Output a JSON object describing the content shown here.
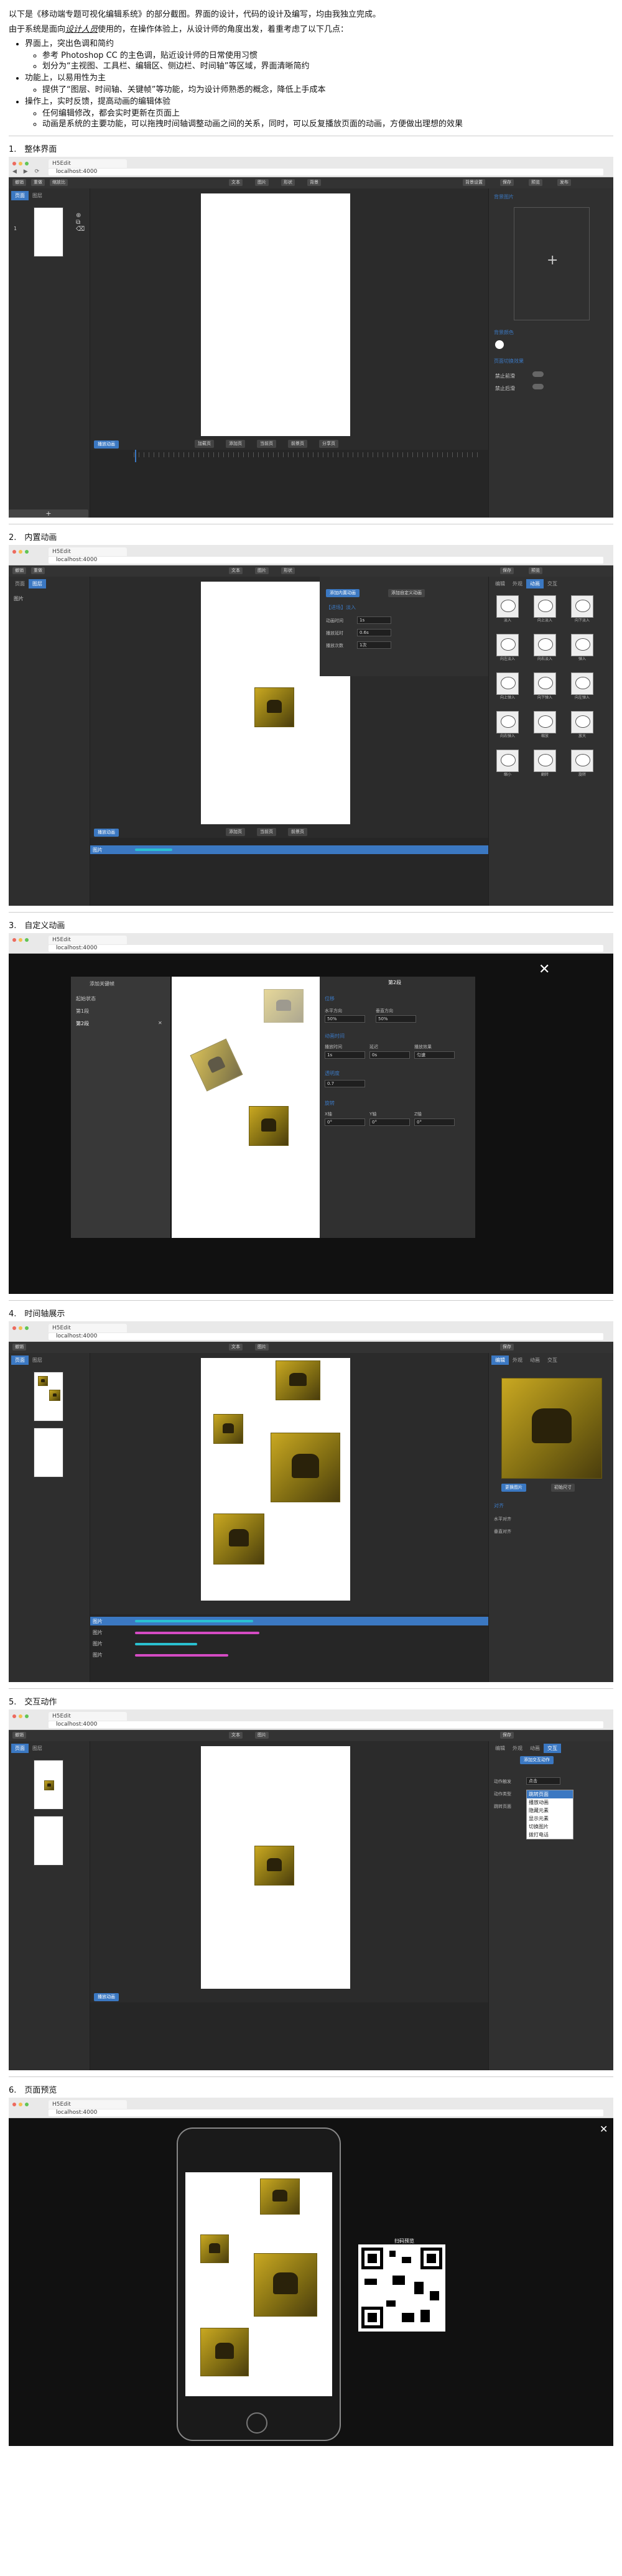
{
  "intro": {
    "line1": "以下是《移动端专题可视化编辑系统》的部分截图。界面的设计，代码的设计及编写，均由我独立完成。",
    "line2_pre": "由于系统是面向",
    "line2_em": "设计人员",
    "line2_post": "使用的，在操作体验上，从设计师的角度出发，着重考虑了以下几点：",
    "points": [
      {
        "text": "界面上，突出色调和简约",
        "sub": [
          "参考 Photoshop CC 的主色调，贴近设计师的日常使用习惯",
          "划分为“主视图、工具栏、编辑区、侧边栏、时间轴”等区域，界面清晰简约"
        ]
      },
      {
        "text": "功能上，以易用性为主",
        "sub": [
          "提供了“图层、时间轴、关键帧”等功能，均为设计师熟悉的概念，降低上手成本"
        ]
      },
      {
        "text": "操作上，实时反馈，提高动画的编辑体验",
        "sub": [
          "任何编辑修改，都会实时更新在页面上",
          "动画是系统的主要功能，可以拖拽时间轴调整动画之间的关系，同时，可以反复播放页面的动画，方便做出理想的效果"
        ]
      }
    ]
  },
  "sections": [
    {
      "title": "1.　整体界面"
    },
    {
      "title": "2.　内置动画"
    },
    {
      "title": "3.　自定义动画"
    },
    {
      "title": "4.　时间轴展示"
    },
    {
      "title": "5.　交互动作"
    },
    {
      "title": "6.　页面预览"
    }
  ],
  "browser": {
    "tab": "H5Edit",
    "url": "localhost:4000"
  },
  "toolbar": {
    "left": [
      "撤销",
      "重做",
      "缩放比"
    ],
    "center": [
      "文本",
      "图片",
      "形状",
      "背景"
    ],
    "right": [
      "背景设置",
      "保存",
      "预览",
      "发布"
    ]
  },
  "editor": {
    "left_tabs": [
      "页面",
      "图层"
    ],
    "add_btn": "+",
    "play_btn": "播放动画",
    "bottom_btns": [
      "加载页",
      "添加页",
      "当前页",
      "前景页",
      "分享页"
    ],
    "right_tabs": [
      "编辑",
      "外观",
      "动画",
      "交互"
    ],
    "bg_image_label": "背景图片",
    "bg_color_label": "背景颜色",
    "page_switch_label": "页面切换效果",
    "switch_rows": [
      "禁止前滑",
      "禁止后滑"
    ],
    "anim_tabs": [
      "添加动画",
      "动画效果"
    ],
    "builtin_btns": [
      "添加内置动画",
      "添加自定义动画"
    ],
    "anim_item": "【进场】淡入",
    "anim_fields": [
      {
        "label": "动画时间",
        "value": "1s"
      },
      {
        "label": "播放延时",
        "value": "0.6s"
      },
      {
        "label": "播放次数",
        "value": "1次"
      }
    ],
    "layer_item": "图片",
    "panda_labels": [
      "淡入",
      "向上淡入",
      "向下淡入",
      "向左淡入",
      "向右淡入",
      "弹入",
      "向上弹入",
      "向下弹入",
      "向左弹入",
      "向右弹入",
      "缩放",
      "放大",
      "缩小",
      "翻转",
      "旋转"
    ]
  },
  "custom_anim": {
    "list_header": "添加关键帧",
    "keyframes": [
      "起始状态",
      "第1段",
      "第2段"
    ],
    "title": "第2段",
    "sections": [
      {
        "name": "位移",
        "fields": [
          {
            "label": "水平方向",
            "value": "50%"
          },
          {
            "label": "垂直方向",
            "value": "50%"
          }
        ]
      },
      {
        "name": "动画时间",
        "fields": [
          {
            "label": "播放时间",
            "value": "1s"
          },
          {
            "label": "延迟",
            "value": "0s"
          },
          {
            "label": "播放效果",
            "value": "匀速"
          }
        ]
      },
      {
        "name": "透明度",
        "fields": [
          {
            "label": "",
            "value": "0.7"
          }
        ]
      },
      {
        "name": "旋转",
        "fields": [
          {
            "label": "X轴",
            "value": "0°"
          },
          {
            "label": "Y轴",
            "value": "0°"
          },
          {
            "label": "Z轴",
            "value": "0°"
          }
        ]
      }
    ]
  },
  "timeline4": {
    "rows": [
      "图片",
      "图片",
      "图片",
      "图片"
    ],
    "right_btns": [
      "更换图片",
      "初始尺寸"
    ],
    "align_label": "对齐",
    "labels": [
      "水平对齐",
      "垂直对齐"
    ]
  },
  "interaction": {
    "add_btn": "添加交互动作",
    "fields": [
      "动作触发",
      "动作类型",
      "跳转页面"
    ],
    "trigger_value": "点击",
    "menu": [
      "跳转页面",
      "播放动画",
      "隐藏元素",
      "显示元素",
      "切换图片",
      "拨打电话"
    ],
    "selected": "跳转页面"
  },
  "preview": {
    "qr_label": "扫码预览"
  },
  "colors": {
    "accent": "#3b78c2",
    "bg": "#2a2a2a",
    "pink": "#d44bc3",
    "cyan": "#2ac0d0"
  }
}
